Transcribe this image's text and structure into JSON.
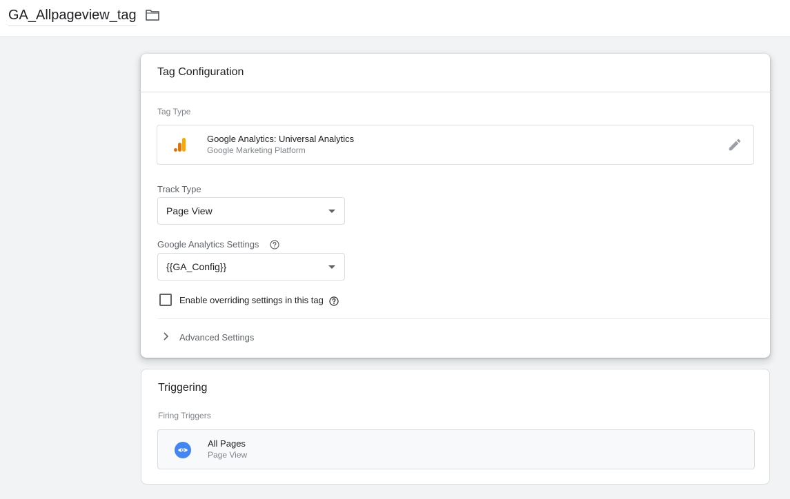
{
  "header": {
    "tag_name": "GA_Allpageview_tag",
    "folder_icon": "folder-icon"
  },
  "tag_configuration": {
    "title": "Tag Configuration",
    "tag_type_label": "Tag Type",
    "tag_type": {
      "name": "Google Analytics: Universal Analytics",
      "provider": "Google Marketing Platform",
      "icon": "google-analytics-icon",
      "edit_icon": "pencil-icon"
    },
    "track_type": {
      "label": "Track Type",
      "value": "Page View"
    },
    "ga_settings": {
      "label": "Google Analytics Settings",
      "value": "{{GA_Config}}",
      "help_icon": "help-icon"
    },
    "override": {
      "label": "Enable overriding settings in this tag",
      "checked": false
    },
    "advanced": {
      "label": "Advanced Settings",
      "icon": "chevron-right-icon"
    }
  },
  "triggering": {
    "title": "Triggering",
    "firing_label": "Firing Triggers",
    "trigger": {
      "name": "All Pages",
      "type": "Page View",
      "icon": "eye-icon"
    }
  },
  "colors": {
    "background": "#f1f3f4",
    "ga_orange": "#f9ab00",
    "ga_dark_orange": "#e37400",
    "trigger_blue": "#4285f4"
  }
}
